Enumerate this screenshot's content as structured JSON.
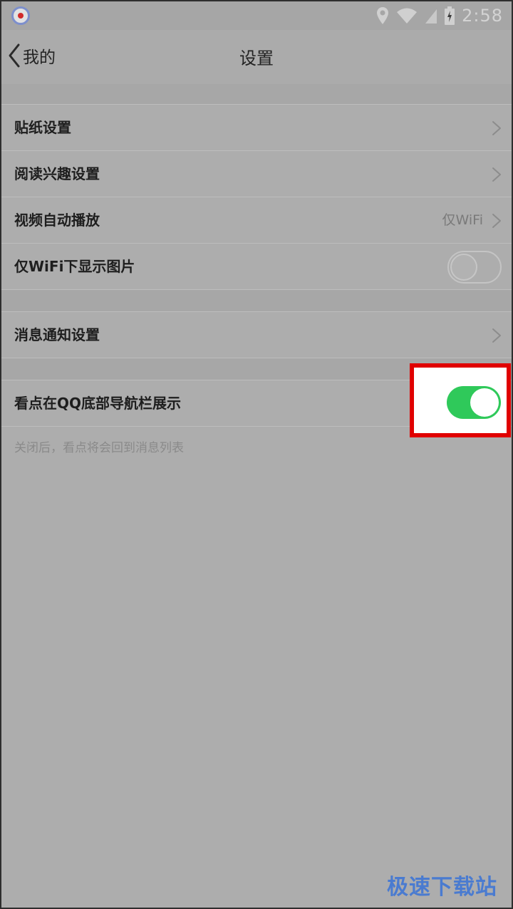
{
  "status_bar": {
    "app_icon": "recorder-icon",
    "icons": [
      "location-icon",
      "wifi-icon",
      "signal-icon",
      "battery-charging-icon"
    ],
    "time": "2:58"
  },
  "nav": {
    "back_label": "我的",
    "title": "设置"
  },
  "settings": {
    "sticker": {
      "label": "贴纸设置"
    },
    "reading_interest": {
      "label": "阅读兴趣设置"
    },
    "video_autoplay": {
      "label": "视频自动播放",
      "value": "仅WiFi"
    },
    "wifi_images": {
      "label": "仅WiFi下显示图片",
      "toggle": "off"
    },
    "notifications": {
      "label": "消息通知设置"
    },
    "kandian_nav": {
      "label": "看点在QQ底部导航栏展示",
      "toggle": "on"
    },
    "kandian_note": "关闭后，看点将会回到消息列表"
  },
  "colors": {
    "toggle_on": "#2fc95a",
    "highlight": "#e00000",
    "watermark": "#4a7bd0"
  },
  "watermark": "极速下载站"
}
